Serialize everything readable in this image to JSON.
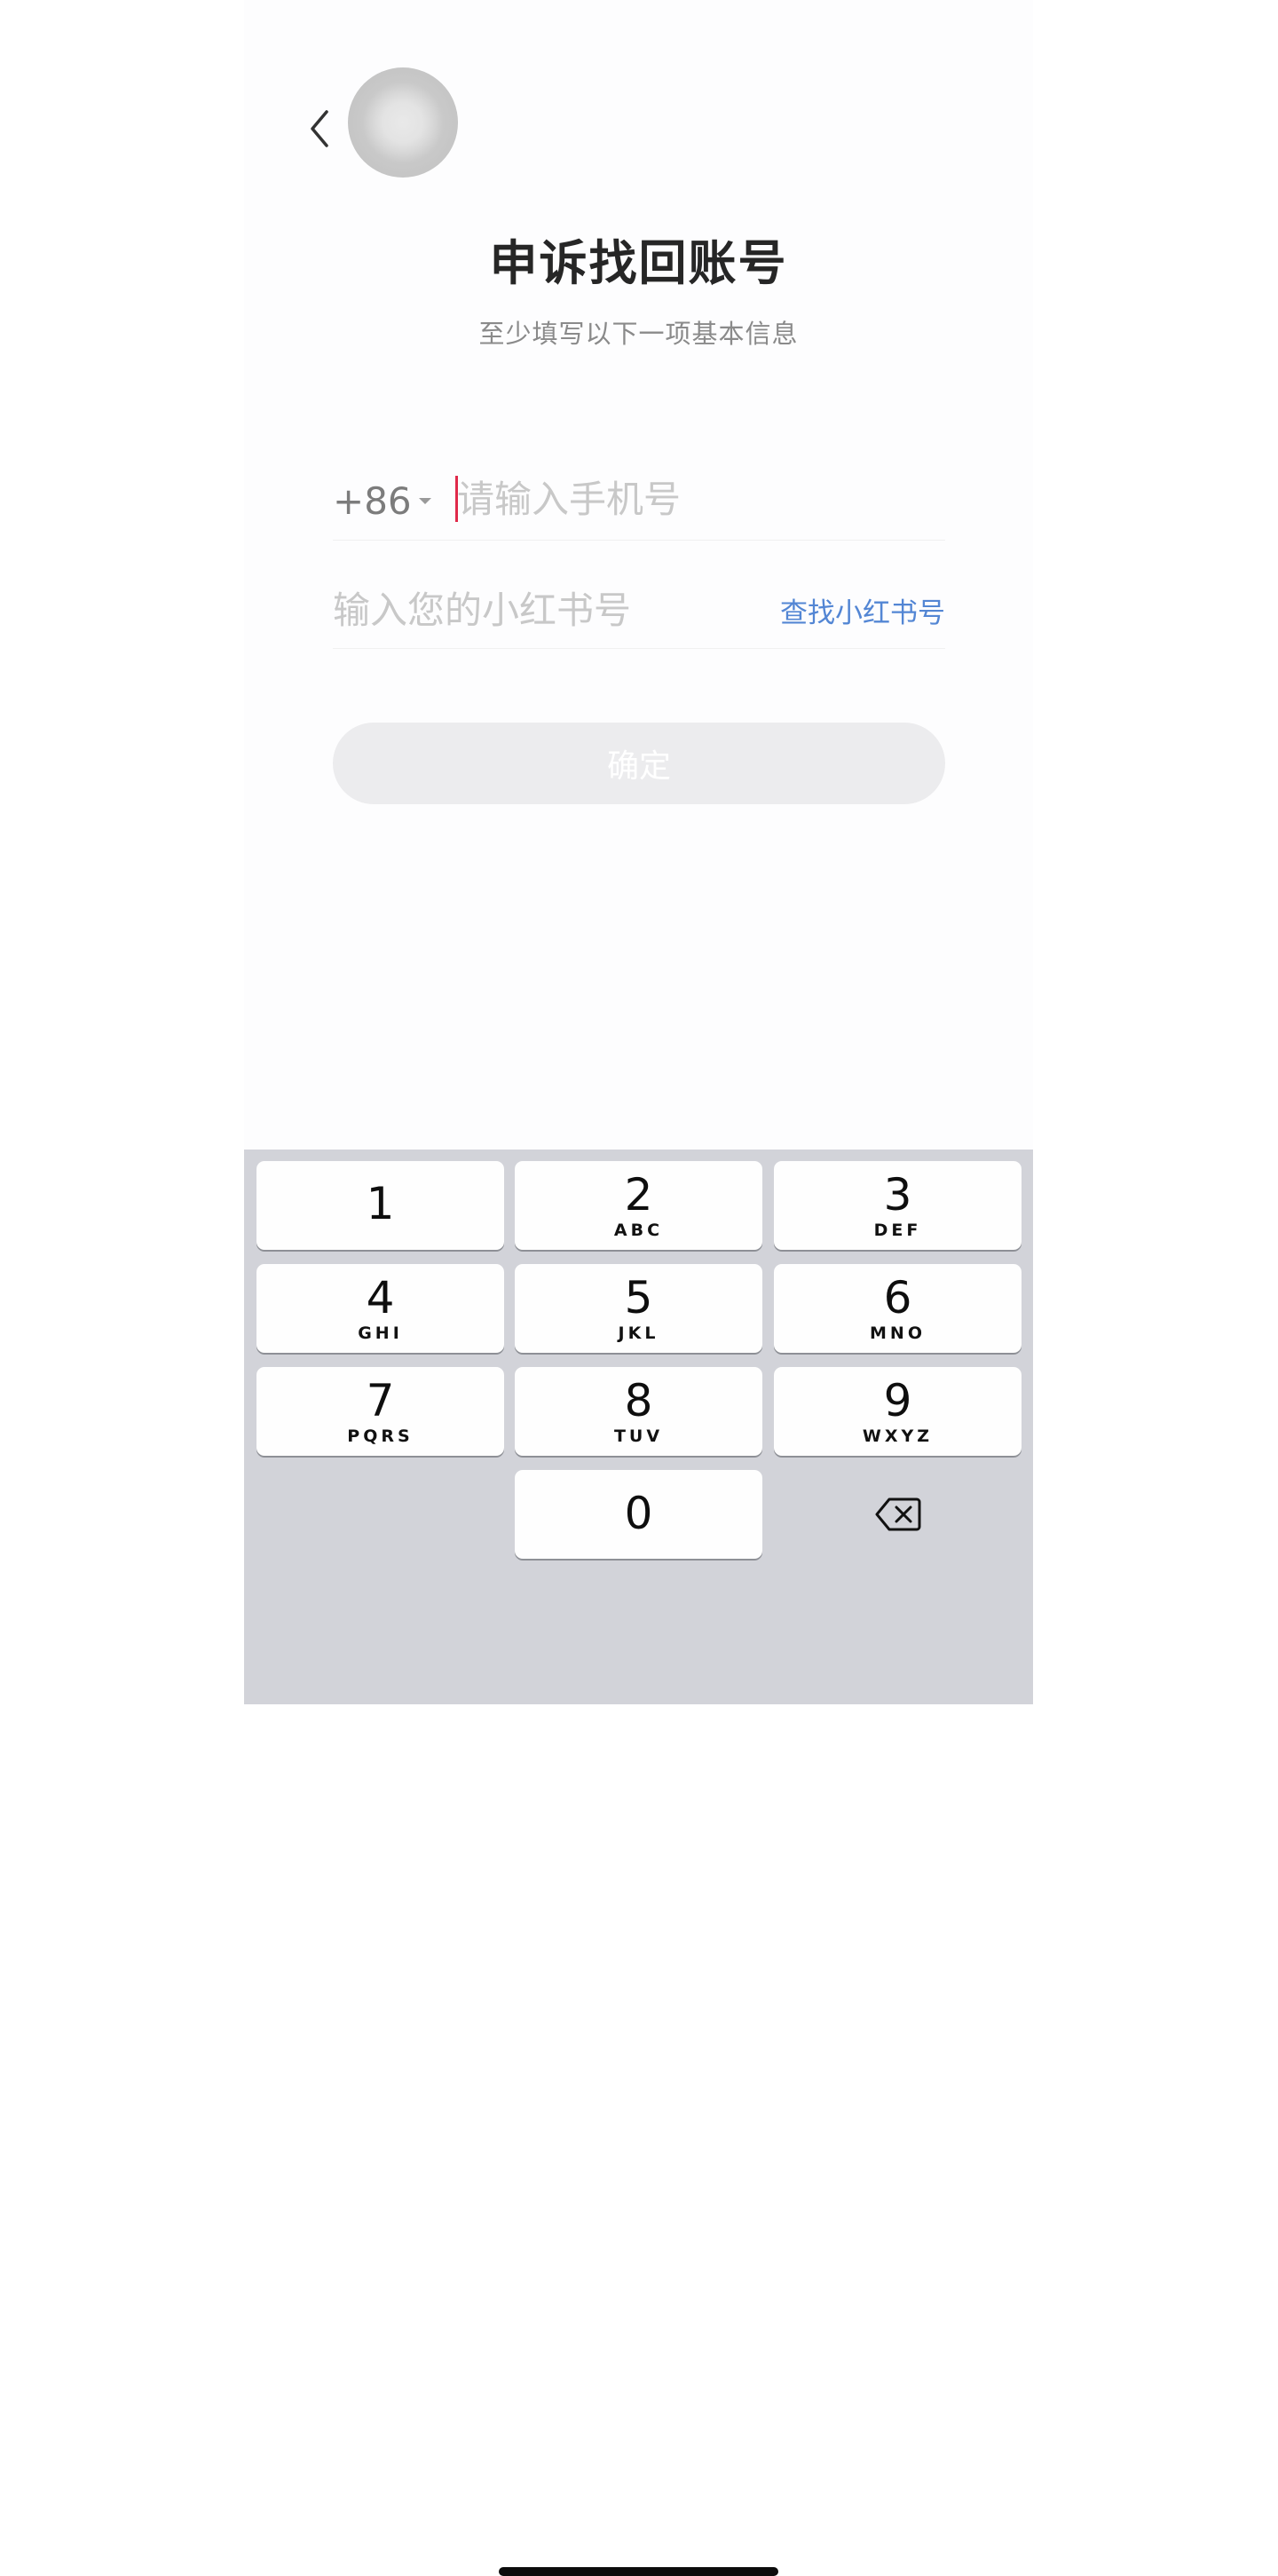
{
  "header": {
    "back_icon": "chevron-left-icon",
    "title": "申诉找回账号",
    "subtitle": "至少填写以下一项基本信息"
  },
  "form": {
    "country_code": "+86",
    "phone_placeholder": "请输入手机号",
    "phone_value": "",
    "id_placeholder": "输入您的小红书号",
    "id_value": "",
    "find_link": "查找小红书号",
    "confirm_label": "确定"
  },
  "keyboard": {
    "keys": [
      {
        "digit": "1",
        "letters": ""
      },
      {
        "digit": "2",
        "letters": "ABC"
      },
      {
        "digit": "3",
        "letters": "DEF"
      },
      {
        "digit": "4",
        "letters": "GHI"
      },
      {
        "digit": "5",
        "letters": "JKL"
      },
      {
        "digit": "6",
        "letters": "MNO"
      },
      {
        "digit": "7",
        "letters": "PQRS"
      },
      {
        "digit": "8",
        "letters": "TUV"
      },
      {
        "digit": "9",
        "letters": "WXYZ"
      },
      {
        "digit": "0",
        "letters": ""
      }
    ],
    "delete_icon": "backspace-icon"
  },
  "colors": {
    "cursor": "#e0294a",
    "link": "#5386d4",
    "button_disabled": "#ececee",
    "keyboard_bg": "#d2d3d9"
  }
}
